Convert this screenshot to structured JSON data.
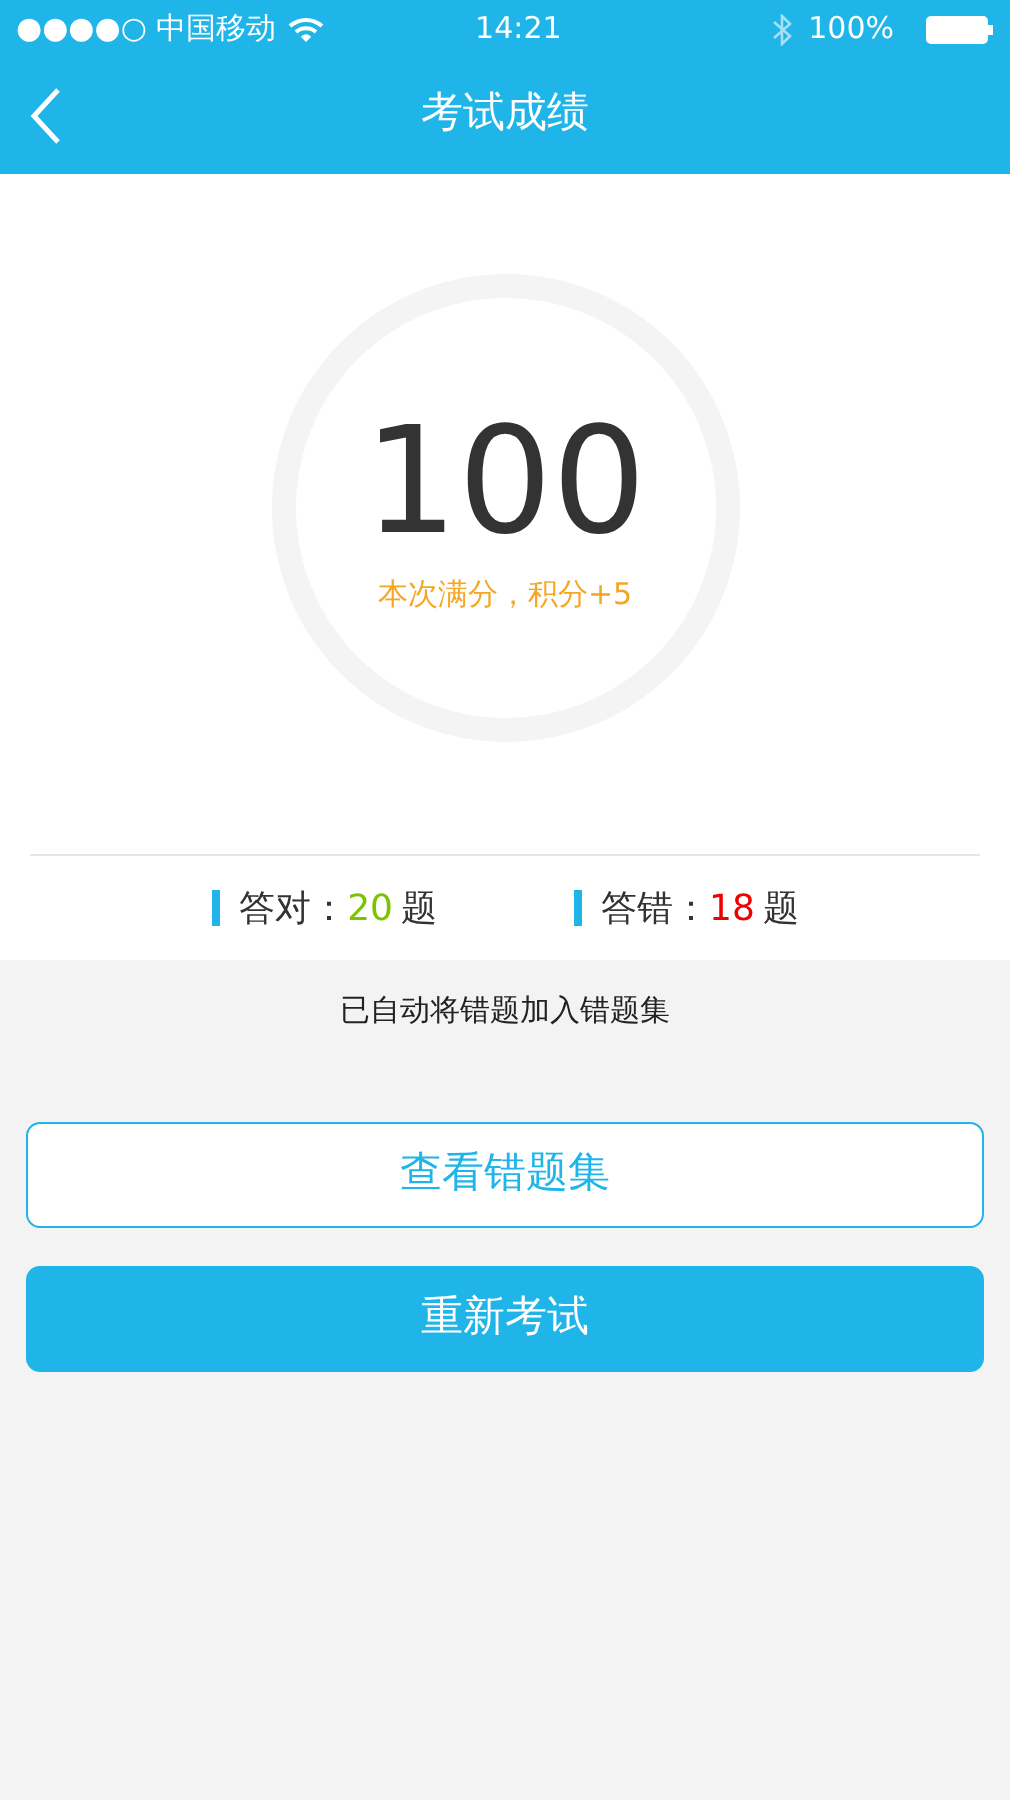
{
  "status_bar": {
    "carrier": "●●●●○ 中国移动",
    "time": "14:21",
    "battery": "100%"
  },
  "nav": {
    "title": "考试成绩"
  },
  "score": {
    "value": "100",
    "note": "本次满分，积分+5"
  },
  "stats": [
    {
      "label": "答对：",
      "count": "20",
      "unit": "题",
      "color": "#7cc400"
    },
    {
      "label": "答错：",
      "count": "18",
      "unit": "题",
      "color": "#f00000"
    }
  ],
  "notice": "已自动将错题加入错题集",
  "buttons": [
    {
      "label": "查看错题集",
      "kind": "outline"
    },
    {
      "label": "重新考试",
      "kind": "filled"
    }
  ]
}
